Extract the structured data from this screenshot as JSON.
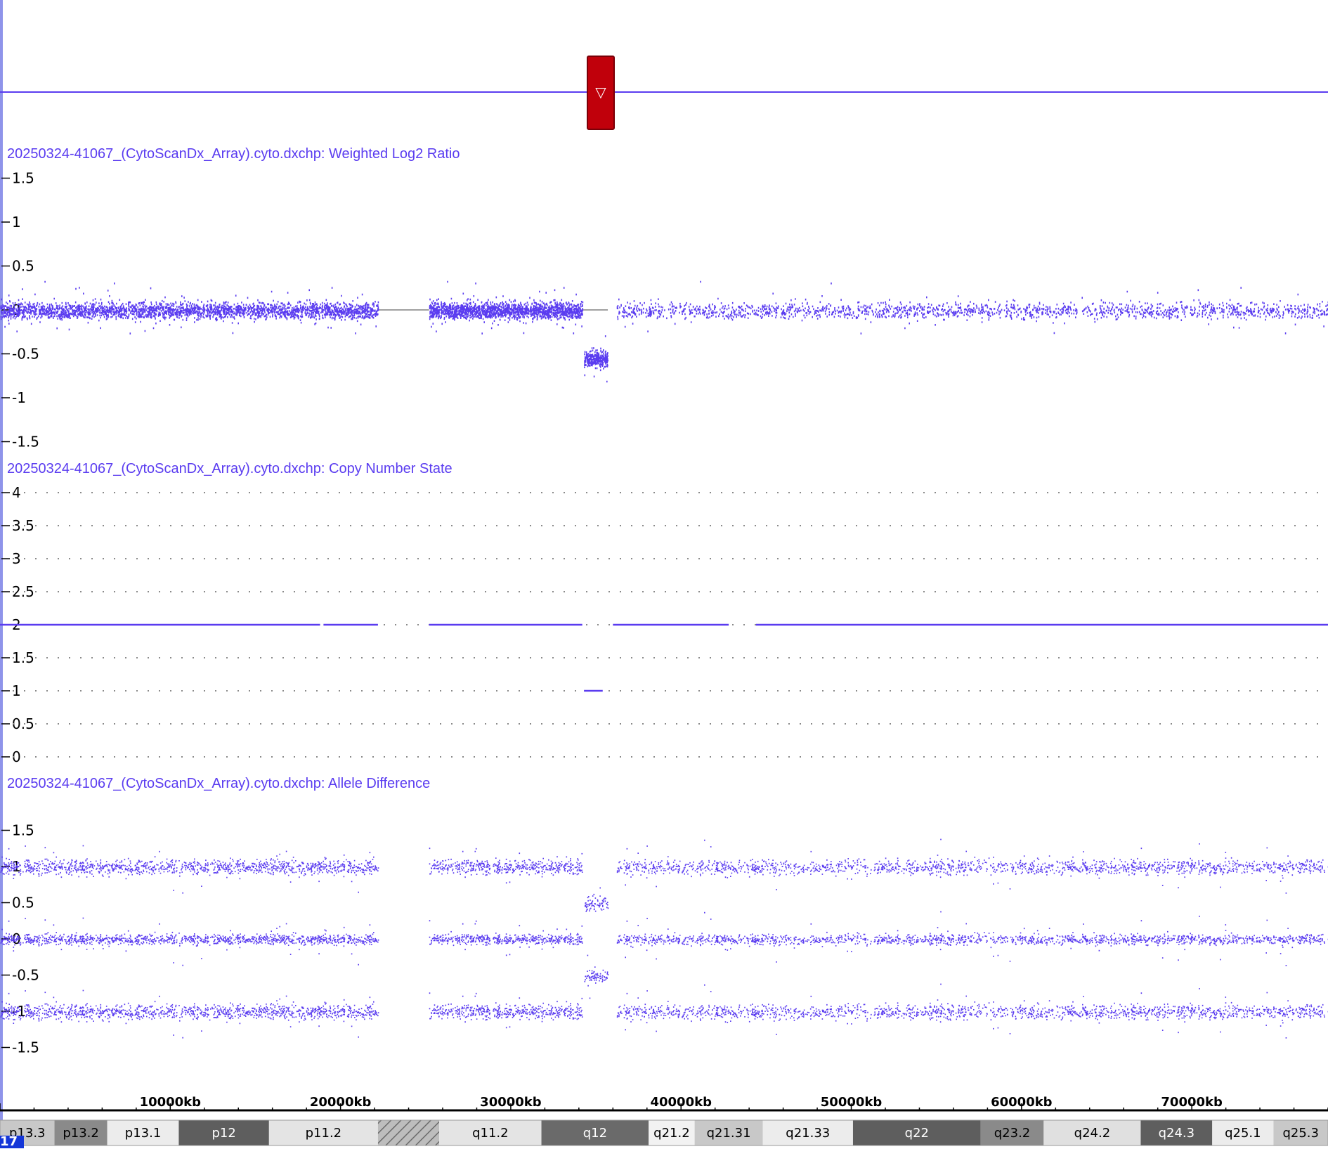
{
  "colors": {
    "accent": "#5a3cf0",
    "marker": "#c0000b",
    "axis": "#000000",
    "left_rule": "#8f94ea",
    "chrom_badge": "#1436d8"
  },
  "marker": {
    "glyph": "▽",
    "icon": "triangle-down-icon"
  },
  "chromosome": {
    "label": "17"
  },
  "tracks": {
    "log2": {
      "title": "20250324-41067_(CytoScanDx_Array).cyto.dxchp: Weighted Log2 Ratio"
    },
    "cn": {
      "title": "20250324-41067_(CytoScanDx_Array).cyto.dxchp: Copy Number State"
    },
    "ad": {
      "title": "20250324-41067_(CytoScanDx_Array).cyto.dxchp: Allele Difference"
    }
  },
  "chart_data": [
    {
      "type": "scatter",
      "title": "20250324-41067_(CytoScanDx_Array).cyto.dxchp: Weighted Log2 Ratio",
      "x_unit": "kb",
      "xlim": [
        0,
        78000
      ],
      "ylim": [
        -1.6,
        1.6
      ],
      "y_ticks": [
        "1.5",
        "1",
        "0.5",
        "0",
        "-0.5",
        "-1",
        "-1.5"
      ],
      "gaps_kb": [
        [
          22200,
          25200
        ],
        [
          43000,
          43600
        ]
      ],
      "segments": [
        {
          "start_kb": 0,
          "end_kb": 22200,
          "median": 0.0
        },
        {
          "start_kb": 25200,
          "end_kb": 34200,
          "median": 0.0
        },
        {
          "start_kb": 34300,
          "end_kb": 35700,
          "median": -0.55
        },
        {
          "start_kb": 36200,
          "end_kb": 78000,
          "median": 0.0
        }
      ]
    },
    {
      "type": "line",
      "title": "20250324-41067_(CytoScanDx_Array).cyto.dxchp: Copy Number State",
      "x_unit": "kb",
      "xlim": [
        0,
        78000
      ],
      "ylim": [
        0,
        4
      ],
      "y_ticks": [
        "4",
        "3.5",
        "3",
        "2.5",
        "2",
        "1.5",
        "1",
        "0.5",
        "0"
      ],
      "segments": [
        {
          "start_kb": 0,
          "end_kb": 18800,
          "value": 2
        },
        {
          "start_kb": 19000,
          "end_kb": 22200,
          "value": 2
        },
        {
          "start_kb": 25200,
          "end_kb": 34200,
          "value": 2
        },
        {
          "start_kb": 34300,
          "end_kb": 35400,
          "value": 1
        },
        {
          "start_kb": 36000,
          "end_kb": 42800,
          "value": 2
        },
        {
          "start_kb": 44400,
          "end_kb": 78000,
          "value": 2
        }
      ]
    },
    {
      "type": "scatter",
      "title": "20250324-41067_(CytoScanDx_Array).cyto.dxchp: Allele Difference",
      "x_unit": "kb",
      "xlim": [
        0,
        78000
      ],
      "ylim": [
        -1.6,
        1.9
      ],
      "y_ticks": [
        "1.5",
        "1",
        "0.5",
        "0",
        "-0.5",
        "-1",
        "-1.5"
      ],
      "bands": [
        {
          "start_kb": 0,
          "end_kb": 34200,
          "levels": [
            1,
            0,
            -1
          ]
        },
        {
          "start_kb": 34300,
          "end_kb": 35700,
          "levels": [
            0.5,
            -0.5
          ]
        },
        {
          "start_kb": 36200,
          "end_kb": 78000,
          "levels": [
            1,
            0,
            -1
          ]
        }
      ],
      "gaps_kb": [
        [
          22200,
          25200
        ]
      ]
    }
  ],
  "x_axis": {
    "labels": [
      "10000kb",
      "20000kb",
      "30000kb",
      "40000kb",
      "50000kb",
      "60000kb",
      "70000kb"
    ],
    "values": [
      10000,
      20000,
      30000,
      40000,
      50000,
      60000,
      70000
    ]
  },
  "ideogram": [
    {
      "name": "p13.3",
      "start": 0,
      "end": 3200,
      "shade": "#c8c8c8",
      "text": "#000000"
    },
    {
      "name": "p13.2",
      "start": 3200,
      "end": 6300,
      "shade": "#8a8a8a",
      "text": "#000000"
    },
    {
      "name": "p13.1",
      "start": 6300,
      "end": 10500,
      "shade": "#ececec",
      "text": "#000000"
    },
    {
      "name": "p12",
      "start": 10500,
      "end": 15800,
      "shade": "#5e5e5e",
      "text": "#ffffff"
    },
    {
      "name": "p11.2",
      "start": 15800,
      "end": 22200,
      "shade": "#e4e4e4",
      "text": "#000000"
    },
    {
      "name": "",
      "start": 22200,
      "end": 25800,
      "shade": "hatch",
      "text": "#000000"
    },
    {
      "name": "q11.2",
      "start": 25800,
      "end": 31800,
      "shade": "#e4e4e4",
      "text": "#000000"
    },
    {
      "name": "q12",
      "start": 31800,
      "end": 38100,
      "shade": "#6a6a6a",
      "text": "#ffffff"
    },
    {
      "name": "q21.2",
      "start": 38100,
      "end": 40800,
      "shade": "#f2f2f2",
      "text": "#000000"
    },
    {
      "name": "q21.31",
      "start": 40800,
      "end": 44800,
      "shade": "#c8c8c8",
      "text": "#000000"
    },
    {
      "name": "q21.33",
      "start": 44800,
      "end": 50100,
      "shade": "#ececec",
      "text": "#000000"
    },
    {
      "name": "q22",
      "start": 50100,
      "end": 57600,
      "shade": "#5e5e5e",
      "text": "#ffffff"
    },
    {
      "name": "q23.2",
      "start": 57600,
      "end": 61300,
      "shade": "#8a8a8a",
      "text": "#000000"
    },
    {
      "name": "q24.2",
      "start": 61300,
      "end": 67000,
      "shade": "#e0e0e0",
      "text": "#000000"
    },
    {
      "name": "q24.3",
      "start": 67000,
      "end": 71200,
      "shade": "#5e5e5e",
      "text": "#ffffff"
    },
    {
      "name": "q25.1",
      "start": 71200,
      "end": 74800,
      "shade": "#ececec",
      "text": "#000000"
    },
    {
      "name": "q25.3",
      "start": 74800,
      "end": 78000,
      "shade": "#c8c8c8",
      "text": "#000000"
    }
  ]
}
